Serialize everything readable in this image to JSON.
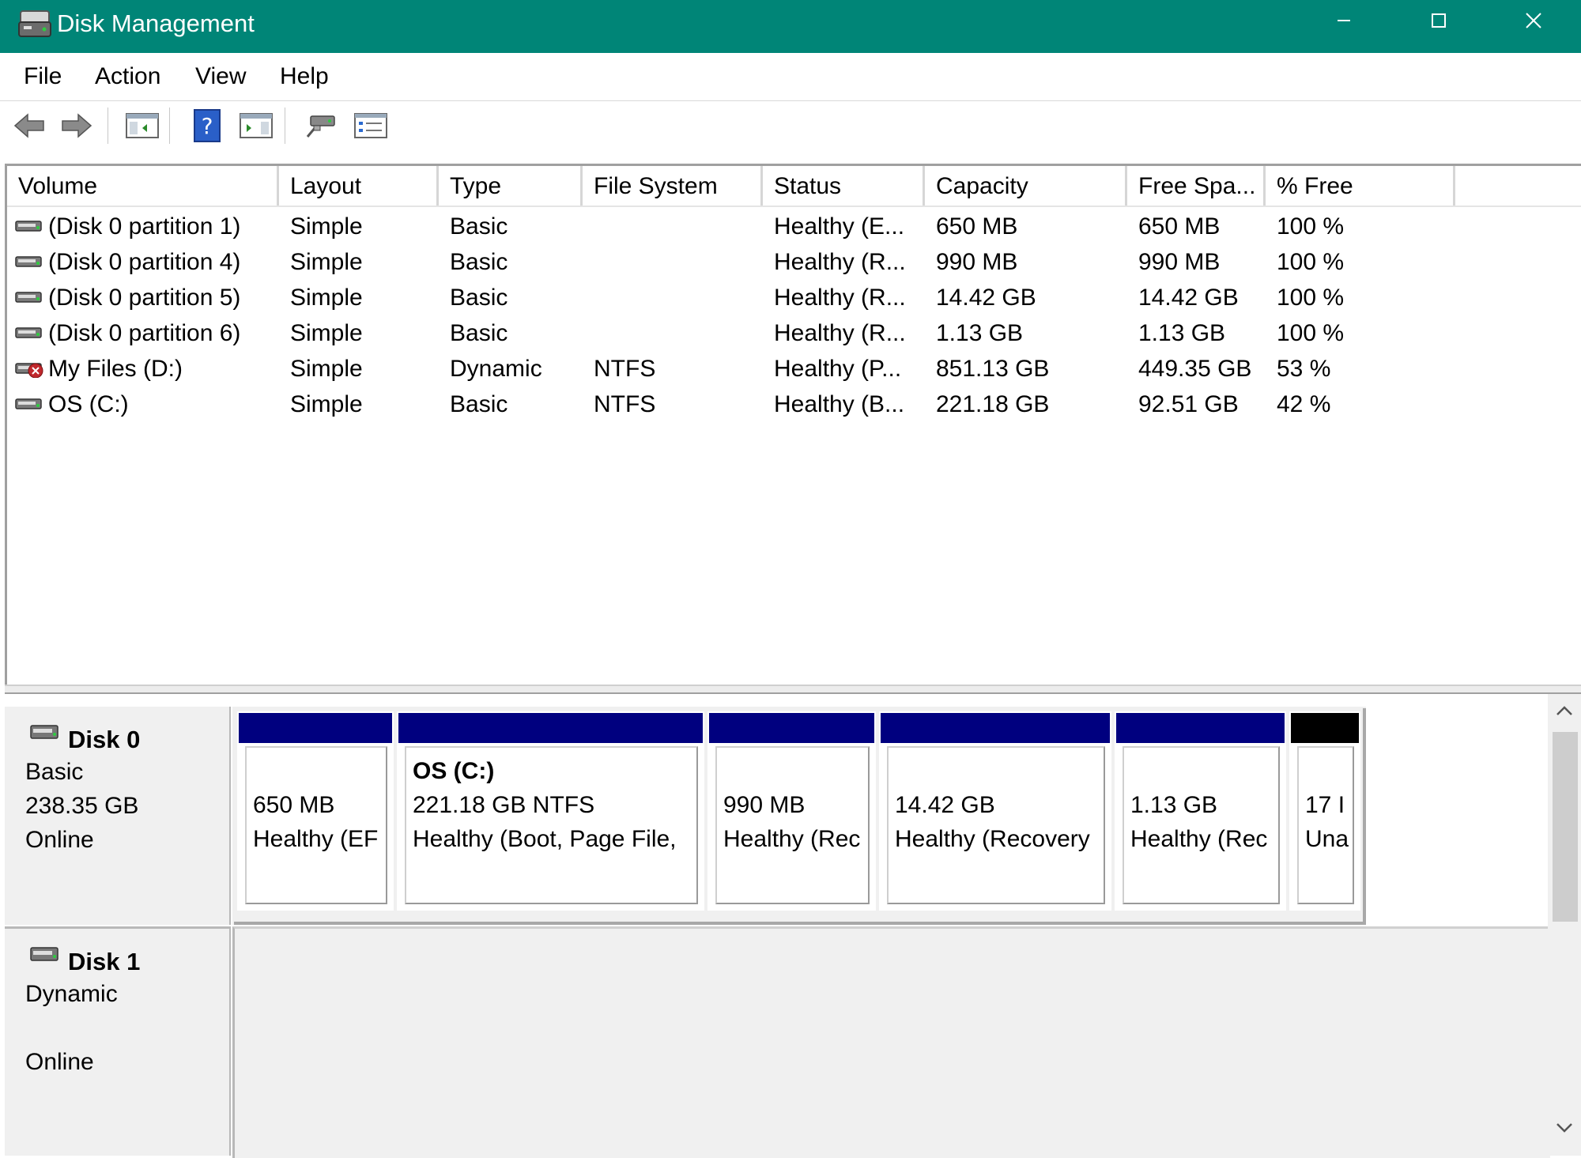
{
  "window": {
    "title": "Disk Management",
    "title_bar_color": "#008577"
  },
  "menu": [
    "File",
    "Action",
    "View",
    "Help"
  ],
  "toolbar": {
    "buttons": [
      "back-icon",
      "forward-icon",
      "console-tree-icon",
      "help-icon",
      "action-pane-icon",
      "connect-icon",
      "properties-icon"
    ]
  },
  "volume_table": {
    "columns": [
      "Volume",
      "Layout",
      "Type",
      "File System",
      "Status",
      "Capacity",
      "Free Spa...",
      "% Free"
    ],
    "rows": [
      {
        "volume": "(Disk 0 partition 1)",
        "layout": "Simple",
        "type": "Basic",
        "fs": "",
        "status": "Healthy (E...",
        "capacity": "650 MB",
        "free": "650 MB",
        "pct": "100 %",
        "icon": "drive-icon"
      },
      {
        "volume": "(Disk 0 partition 4)",
        "layout": "Simple",
        "type": "Basic",
        "fs": "",
        "status": "Healthy (R...",
        "capacity": "990 MB",
        "free": "990 MB",
        "pct": "100 %",
        "icon": "drive-icon"
      },
      {
        "volume": "(Disk 0 partition 5)",
        "layout": "Simple",
        "type": "Basic",
        "fs": "",
        "status": "Healthy (R...",
        "capacity": "14.42 GB",
        "free": "14.42 GB",
        "pct": "100 %",
        "icon": "drive-icon"
      },
      {
        "volume": "(Disk 0 partition 6)",
        "layout": "Simple",
        "type": "Basic",
        "fs": "",
        "status": "Healthy (R...",
        "capacity": "1.13 GB",
        "free": "1.13 GB",
        "pct": "100 %",
        "icon": "drive-icon"
      },
      {
        "volume": "My Files (D:)",
        "layout": "Simple",
        "type": "Dynamic",
        "fs": "NTFS",
        "status": "Healthy (P...",
        "capacity": "851.13 GB",
        "free": "449.35 GB",
        "pct": "53 %",
        "icon": "drive-error-icon"
      },
      {
        "volume": "OS (C:)",
        "layout": "Simple",
        "type": "Basic",
        "fs": "NTFS",
        "status": "Healthy (B...",
        "capacity": "221.18 GB",
        "free": "92.51 GB",
        "pct": "42 %",
        "icon": "drive-icon"
      }
    ]
  },
  "disks": [
    {
      "name": "Disk 0",
      "type": "Basic",
      "size": "238.35 GB",
      "state": "Online",
      "partitions": [
        {
          "title": "",
          "line1": "650 MB",
          "line2": "Healthy (EF",
          "bar_color": "#00007f"
        },
        {
          "title": "OS  (C:)",
          "line1": "221.18 GB NTFS",
          "line2": "Healthy (Boot, Page File,",
          "bar_color": "#00007f"
        },
        {
          "title": "",
          "line1": "990 MB",
          "line2": "Healthy (Rec",
          "bar_color": "#00007f"
        },
        {
          "title": "",
          "line1": "14.42 GB",
          "line2": "Healthy (Recovery",
          "bar_color": "#00007f"
        },
        {
          "title": "",
          "line1": "1.13 GB",
          "line2": "Healthy (Rec",
          "bar_color": "#00007f"
        },
        {
          "title": "",
          "line1": "17 I",
          "line2": "Una",
          "bar_color": "#000000"
        }
      ]
    },
    {
      "name": "Disk 1",
      "type": "Dynamic",
      "size": "",
      "state": "Online",
      "partitions": []
    }
  ]
}
